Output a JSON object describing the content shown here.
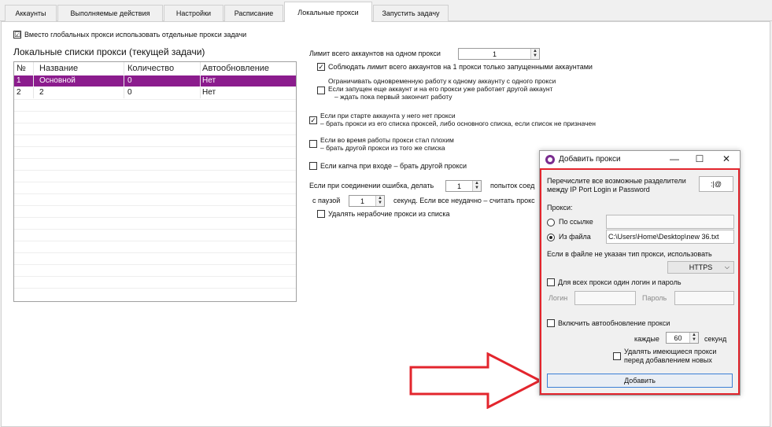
{
  "tabs": [
    {
      "label": "Аккаунты"
    },
    {
      "label": "Выполняемые действия"
    },
    {
      "label": "Настройки"
    },
    {
      "label": "Расписание"
    },
    {
      "label": "Локальные прокси"
    },
    {
      "label": "Запустить задачу"
    }
  ],
  "top_checkbox": {
    "label": "Вместо глобальных прокси использовать отдельные прокси задачи",
    "mark": "☑"
  },
  "list_title": "Локальные списки прокси (текущей задачи)",
  "table": {
    "columns": [
      "№",
      "Название",
      "Количество",
      "Автообновление"
    ],
    "rows": [
      [
        "1",
        "Основной",
        "0",
        "Нет"
      ],
      [
        "2",
        "2",
        "0",
        "Нет"
      ]
    ]
  },
  "settings": {
    "limit_label": "Лимит всего аккаунтов на одном прокси",
    "limit_value": "1",
    "respect_limit": "Соблюдать лимит всего аккаунтов на 1 прокси только запущенными аккаунтами",
    "restrict": [
      "Ограничивать одновременную работу к одному аккаунту с одного прокси",
      "Если запущен еще аккаунт и на его прокси уже работает другой аккаунт",
      "– ждать пока первый закончит работу"
    ],
    "no_proxy": [
      "Если при старте аккаунта у него нет прокси",
      "– брать прокси из его списка проксей, либо основного списка, если список не призначен"
    ],
    "bad_proxy": [
      "Если во время работы прокси стал плохим",
      "– брать другой прокси из того же списка"
    ],
    "captcha": "Если капча при входе – брать другой прокси",
    "conn_error_prefix": "Если при соединении ошибка, делать",
    "conn_error_value": "1",
    "conn_error_suffix": "попыток соед",
    "pause_prefix": "с паузой",
    "pause_value": "1",
    "pause_suffix": "секунд. Если все неудачно – считать прокс",
    "delete_bad": "Удалять нерабочие прокси из списка"
  },
  "dialog": {
    "title": "Добавить прокси",
    "minimize": "—",
    "maximize": "☐",
    "close": "✕",
    "separators_label": [
      "Перечислите все возможные разделители",
      "между IP Port Login и Password"
    ],
    "separators_value": ":|@",
    "proxies_label": "Прокси:",
    "by_link": "По ссылке",
    "from_file": "Из файла",
    "file_path": "C:\\Users\\Home\\Desktop\\new  36.txt",
    "type_label": "Если в файле не указан тип прокси, использовать",
    "type_value": "HTTPS",
    "same_login": "Для всех прокси один логин и пароль",
    "login_label": "Логин",
    "password_label": "Пароль",
    "auto_update": "Включить автообновление прокси",
    "every_label": "каждые",
    "every_value": "60",
    "seconds_label": "секунд",
    "delete_existing": [
      "Удалять имеющиеся прокси",
      "перед добавлением новых"
    ],
    "add_button": "Добавить"
  },
  "colors": {
    "selection": "#8b1c8d",
    "highlight_border": "#e3252d",
    "arrow": "#e3252d"
  }
}
